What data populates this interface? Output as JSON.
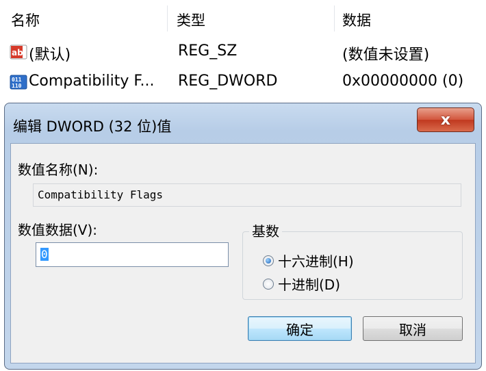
{
  "list": {
    "headers": [
      "名称",
      "类型",
      "数据"
    ],
    "rows": [
      {
        "icon": "string-value-icon",
        "name": "(默认)",
        "type": "REG_SZ",
        "data": "(数值未设置)"
      },
      {
        "icon": "binary-value-icon",
        "name": "Compatibility F...",
        "type": "REG_DWORD",
        "data": "0x00000000 (0)"
      }
    ]
  },
  "dialog": {
    "title": "编辑 DWORD (32 位)值",
    "close_label": "x",
    "value_name_label": "数值名称(N):",
    "value_name": "Compatibility Flags",
    "value_data_label": "数值数据(V):",
    "value_data": "0",
    "base_label": "基数",
    "base_options": [
      {
        "label": "十六进制(H)",
        "selected": true
      },
      {
        "label": "十进制(D)",
        "selected": false
      }
    ],
    "ok_label": "确定",
    "cancel_label": "取消"
  },
  "colors": {
    "title_bar": "#c3d6ec",
    "close_button": "#c7432a",
    "selection": "#3399ff",
    "dialog_face": "#f0f0f0"
  }
}
